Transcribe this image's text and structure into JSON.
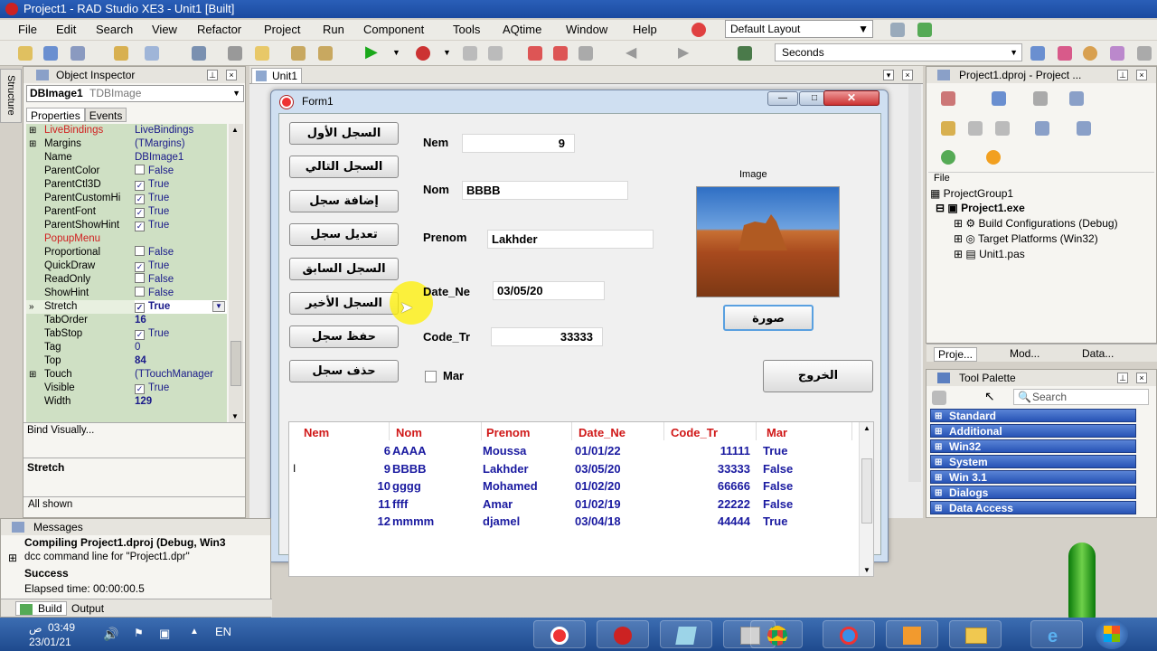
{
  "window": {
    "title": "Project1 - RAD Studio XE3 - Unit1 [Built]"
  },
  "menu": [
    "File",
    "Edit",
    "Search",
    "View",
    "Refactor",
    "Project",
    "Run",
    "Component",
    "Tools",
    "AQtime",
    "Window",
    "Help"
  ],
  "toolbar": {
    "layout": "Default Layout",
    "seconds": "Seconds"
  },
  "structure_tab": "Structure",
  "object_inspector": {
    "title": "Object Inspector",
    "component": "DBImage1",
    "component_type": "TDBImage",
    "tabs": [
      "Properties",
      "Events"
    ],
    "rows": [
      {
        "name": "LiveBindings",
        "value": "LiveBindings",
        "expand": true,
        "red": true
      },
      {
        "name": "Margins",
        "value": "(TMargins)",
        "expand": true
      },
      {
        "name": "Name",
        "value": "DBImage1"
      },
      {
        "name": "ParentColor",
        "value": "False",
        "check": false
      },
      {
        "name": "ParentCtl3D",
        "value": "True",
        "check": true
      },
      {
        "name": "ParentCustomHi",
        "value": "True",
        "check": true
      },
      {
        "name": "ParentFont",
        "value": "True",
        "check": true
      },
      {
        "name": "ParentShowHint",
        "value": "True",
        "check": true
      },
      {
        "name": "PopupMenu",
        "value": "",
        "red": true
      },
      {
        "name": "Proportional",
        "value": "False",
        "check": false
      },
      {
        "name": "QuickDraw",
        "value": "True",
        "check": true
      },
      {
        "name": "ReadOnly",
        "value": "False",
        "check": false
      },
      {
        "name": "ShowHint",
        "value": "False",
        "check": false
      },
      {
        "name": "Stretch",
        "value": "True",
        "check": true,
        "selected": true
      },
      {
        "name": "TabOrder",
        "value": "16",
        "bold": true
      },
      {
        "name": "TabStop",
        "value": "True",
        "check": true
      },
      {
        "name": "Tag",
        "value": "0"
      },
      {
        "name": "Top",
        "value": "84",
        "bold": true
      },
      {
        "name": "Touch",
        "value": "(TTouchManager",
        "expand": true
      },
      {
        "name": "Visible",
        "value": "True",
        "check": true
      },
      {
        "name": "Width",
        "value": "129",
        "bold": true
      }
    ],
    "bind_visually": "Bind Visually...",
    "selected_prop": "Stretch",
    "footer": "All shown"
  },
  "editor": {
    "tab": "Unit1"
  },
  "form": {
    "title": "Form1",
    "buttons": [
      "السجل الأول",
      "السجل التالي",
      "إضافة سجل",
      "تعديل سجل",
      "السجل السابق",
      "السجل الأخير",
      "حفظ سجل",
      "حذف سجل"
    ],
    "fields": {
      "nem_label": "Nem",
      "nem": "9",
      "nom_label": "Nom",
      "nom": "BBBB",
      "prenom_label": "Prenom",
      "prenom": "Lakhder",
      "date_label": "Date_Ne",
      "date": "03/05/20",
      "code_label": "Code_Tr",
      "code": "33333",
      "mar_label": "Mar"
    },
    "image_label": "Image",
    "photo_button": "صورة",
    "exit_button": "الخروج",
    "grid": {
      "columns": [
        "Nem",
        "Nom",
        "Prenom",
        "Date_Ne",
        "Code_Tr",
        "Mar"
      ],
      "rows": [
        [
          "6",
          "AAAA",
          "Moussa",
          "01/01/22",
          "11111",
          "True"
        ],
        [
          "9",
          "BBBB",
          "Lakhder",
          "03/05/20",
          "33333",
          "False"
        ],
        [
          "10",
          "gggg",
          "Mohamed",
          "01/02/20",
          "66666",
          "False"
        ],
        [
          "11",
          "ffff",
          "Amar",
          "01/02/19",
          "22222",
          "False"
        ],
        [
          "12",
          "mmmm",
          "djamel",
          "03/04/18",
          "44444",
          "True"
        ]
      ]
    }
  },
  "project_manager": {
    "title": "Project1.dproj - Project ...",
    "header": "File",
    "items": [
      "ProjectGroup1",
      "Project1.exe",
      "Build Configurations (Debug)",
      "Target Platforms (Win32)",
      "Unit1.pas"
    ],
    "tabs": [
      "Proje...",
      "Mod...",
      "Data..."
    ]
  },
  "tool_palette": {
    "title": "Tool Palette",
    "search": "Search",
    "categories": [
      "Standard",
      "Additional",
      "Win32",
      "System",
      "Win 3.1",
      "Dialogs",
      "Data Access"
    ]
  },
  "messages": {
    "title": "Messages",
    "lines": [
      "Compiling Project1.dproj (Debug, Win3",
      "dcc command line for \"Project1.dpr\"",
      "Success",
      "Elapsed time: 00:00:00.5"
    ],
    "tabs": [
      "Build",
      "Output"
    ]
  },
  "taskbar": {
    "time": "03:49",
    "ampm": "ص",
    "date": "23/01/21",
    "lang": "EN"
  }
}
